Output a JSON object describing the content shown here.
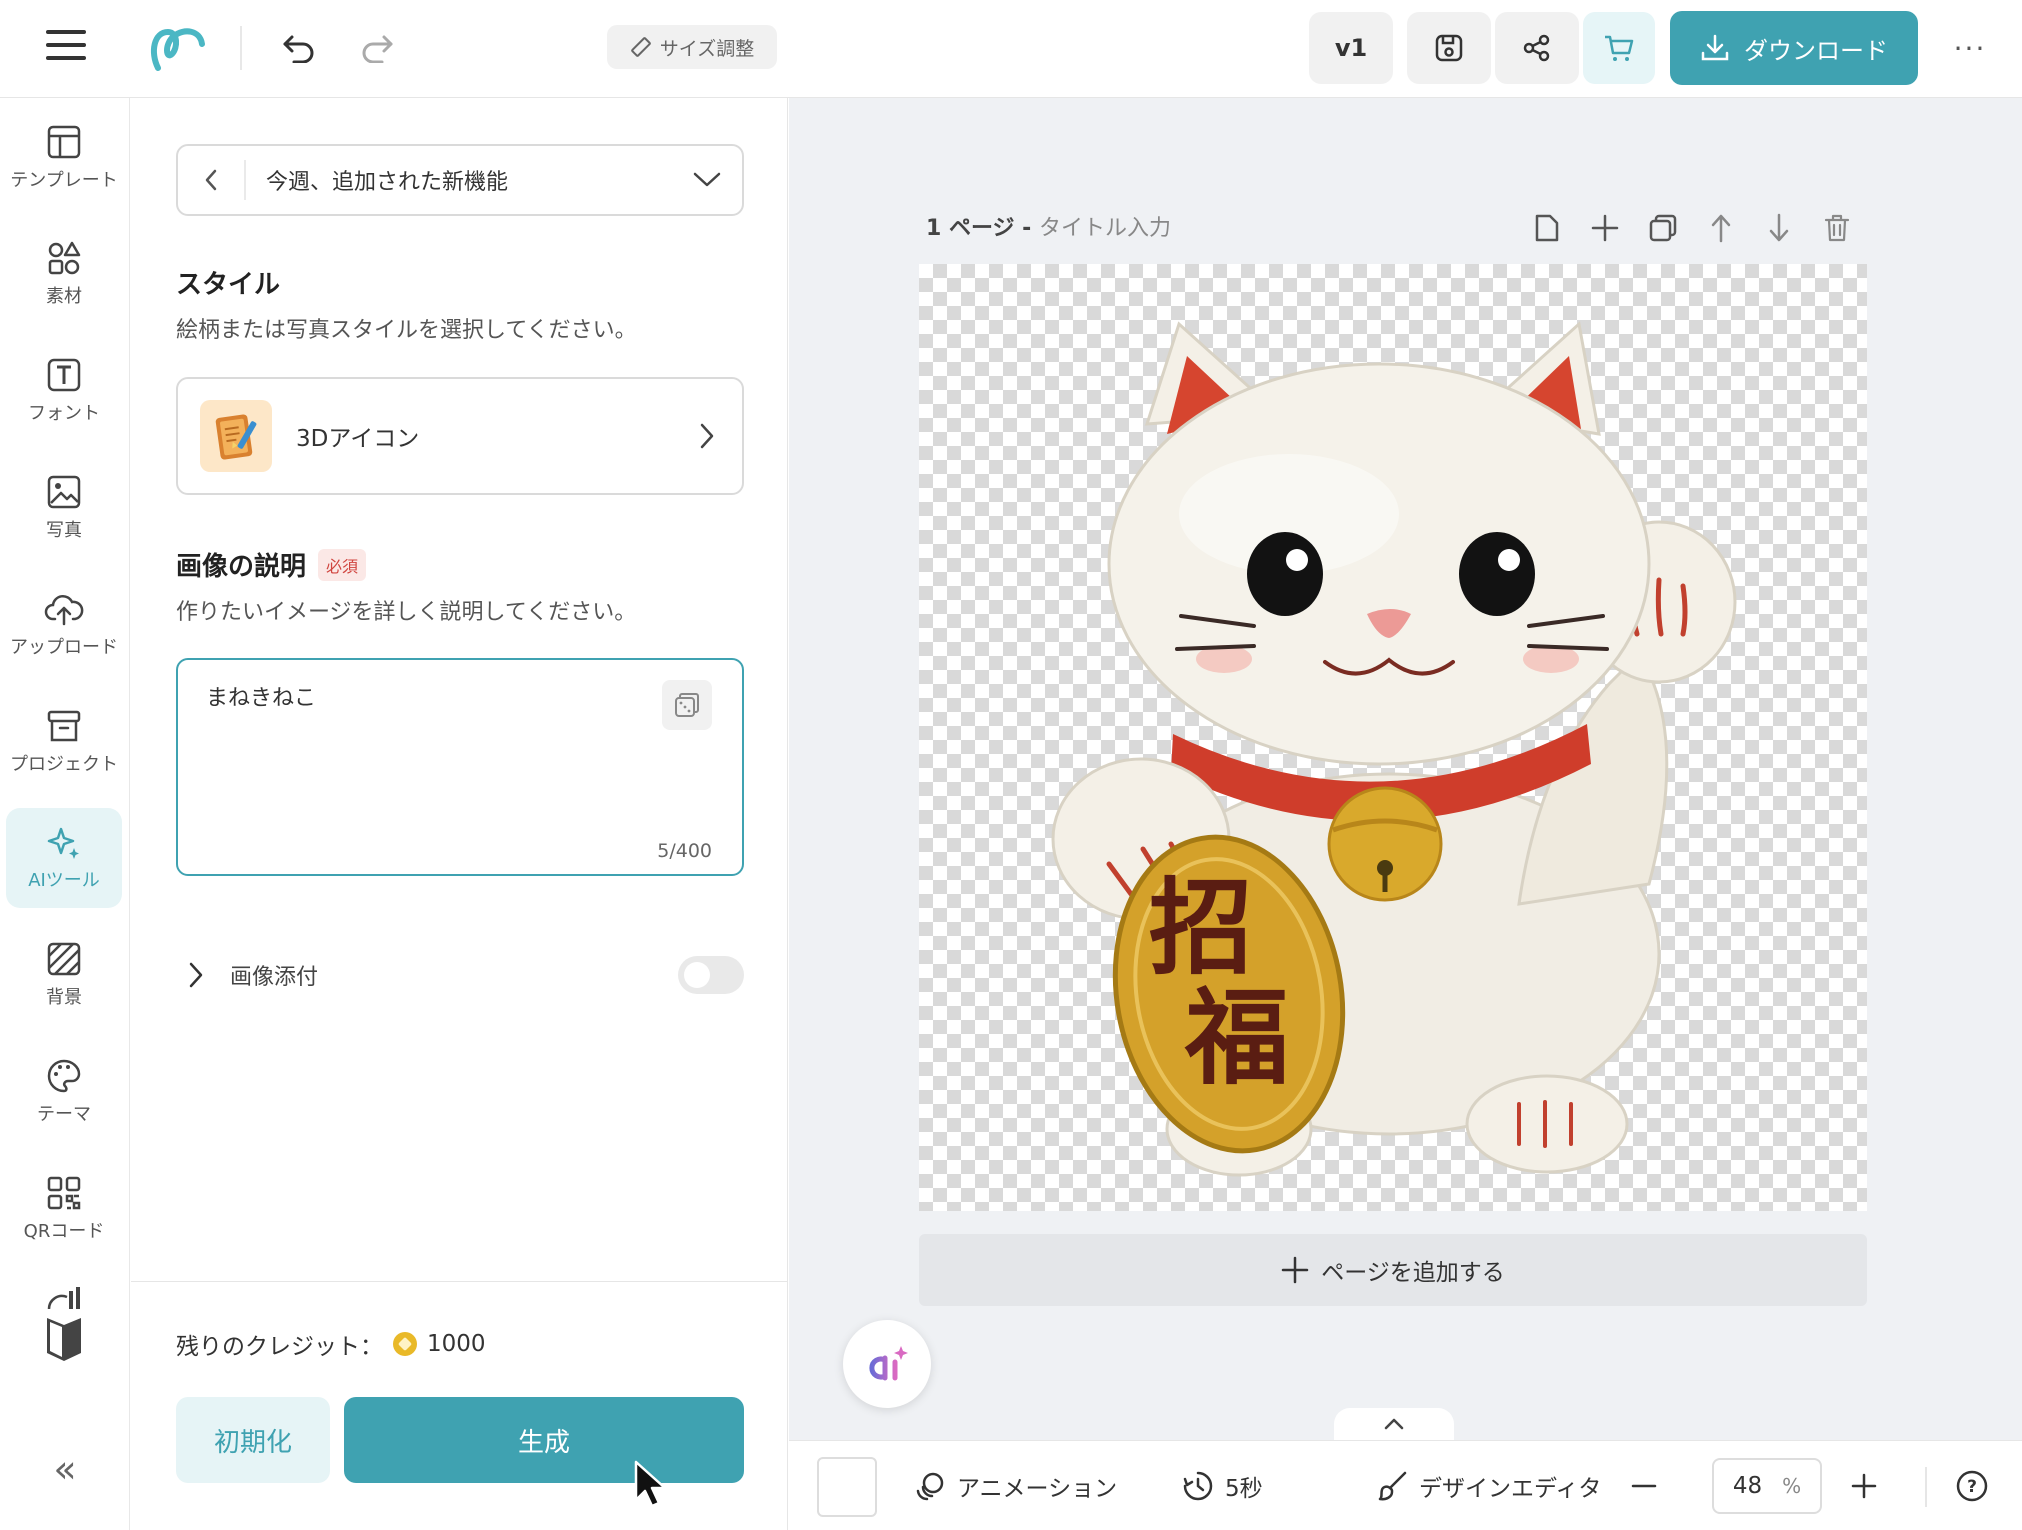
{
  "topbar": {
    "resize_label": "サイズ調整",
    "version_label": "v1",
    "download_label": "ダウンロード",
    "more_label": "···"
  },
  "nav": {
    "items": [
      {
        "label": "テンプレート",
        "icon": "template-icon"
      },
      {
        "label": "素材",
        "icon": "elements-icon"
      },
      {
        "label": "フォント",
        "icon": "font-icon"
      },
      {
        "label": "写真",
        "icon": "photo-icon"
      },
      {
        "label": "アップロード",
        "icon": "upload-icon"
      },
      {
        "label": "プロジェクト",
        "icon": "project-icon"
      },
      {
        "label": "AIツール",
        "icon": "ai-tools-icon",
        "active": true
      },
      {
        "label": "背景",
        "icon": "background-icon"
      },
      {
        "label": "テーマ",
        "icon": "theme-icon"
      },
      {
        "label": "QRコード",
        "icon": "qr-code-icon"
      }
    ],
    "collapse_label": "«"
  },
  "panel": {
    "feature_select": "今週、追加された新機能",
    "style_title": "スタイル",
    "style_desc": "絵柄または写真スタイルを選択してください。",
    "style_value": "3Dアイコン",
    "image_desc_title": "画像の説明",
    "required_badge": "必須",
    "image_desc_hint": "作りたいイメージを詳しく説明してください。",
    "prompt_value": "まねきねこ",
    "prompt_counter": "5/400",
    "attach_label": "画像添付",
    "attach_enabled": false,
    "credits_label": "残りのクレジット：",
    "credits_value": "1000",
    "reset_label": "初期化",
    "generate_label": "生成"
  },
  "canvas": {
    "page_number": "1 ページ - ",
    "page_title_placeholder": "タイトル入力",
    "add_page_label": "ページを追加する",
    "image_alt": "maneki-neko 3D figure with 招福 coin",
    "coin_text": "招福"
  },
  "bottombar": {
    "animation_label": "アニメーション",
    "duration_label": "5秒",
    "design_editor_label": "デザインエディタ",
    "zoom_value": "48",
    "zoom_unit": "%",
    "help_label": "?"
  },
  "colors": {
    "accent": "#3fa2b1",
    "accent_light": "#e6f4f6",
    "required_red": "#d0453f"
  }
}
